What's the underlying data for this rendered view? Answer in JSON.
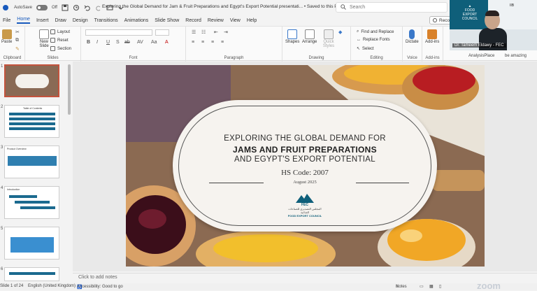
{
  "titlebar": {
    "autosave_label": "AutoSave",
    "autosave_state": "Off",
    "doc_title": "Exploring the Global Demand for Jam & Fruit Preparations and Egypt's Export Potential presentati...",
    "saved_status": "• Saved to this PC",
    "search_placeholder": "Search"
  },
  "menu": [
    "File",
    "Home",
    "Insert",
    "Draw",
    "Design",
    "Transitions",
    "Animations",
    "Slide Show",
    "Record",
    "Review",
    "View",
    "Help"
  ],
  "menu_active": "Home",
  "record_button": "Record",
  "ribbon": {
    "clipboard": {
      "paste": "Paste",
      "label": "Clipboard"
    },
    "slides": {
      "new_slide": "New Slide",
      "layout": "Layout",
      "reset": "Reset",
      "section": "Section",
      "label": "Slides"
    },
    "font": {
      "label": "Font",
      "buttons": [
        "B",
        "I",
        "U",
        "S",
        "ab",
        "AV",
        "Aa",
        "A"
      ]
    },
    "paragraph": {
      "label": "Paragraph"
    },
    "drawing": {
      "shapes": "Shapes",
      "arrange": "Arrange",
      "quick_styles": "Quick Styles",
      "label": "Drawing"
    },
    "editing": {
      "find_replace": "Find and Replace",
      "replace_fonts": "Replace Fonts",
      "select": "Select",
      "label": "Editing"
    },
    "voice": {
      "dictate": "Dictate",
      "label": "Voice"
    },
    "addins": {
      "addins": "Add-ins",
      "label": "Add-ins"
    }
  },
  "webcam": {
    "participant_name": "Dr. Tameem Eldawy - FEC",
    "logo_text": "FOOD EXPORT COUNCIL",
    "side_text": "IIB"
  },
  "under_webcam": {
    "left": "AnalysisPlace",
    "right": "be amazing"
  },
  "thumbnails": [
    {
      "num": "1",
      "title": ""
    },
    {
      "num": "2",
      "title": "Table of Contents"
    },
    {
      "num": "3",
      "title": "Product Overview"
    },
    {
      "num": "4",
      "title": "Introduction"
    },
    {
      "num": "5",
      "title": ""
    },
    {
      "num": "6",
      "title": ""
    }
  ],
  "slide": {
    "line1": "EXPLORING THE GLOBAL DEMAND FOR",
    "line2": "JAMS AND FRUIT PREPARATIONS",
    "line3": "AND EGYPT'S EXPORT POTENTIAL",
    "hs_code": "HS Code: 2007",
    "date": "August 2025",
    "logo_text": "FOOD EXPORT COUNCIL",
    "logo_arabic": "المجلس التصديري للصناعات الغذائية",
    "logo_abbr": "FEC"
  },
  "notes_placeholder": "Click to add notes",
  "status": {
    "slide_counter": "Slide 1 of 24",
    "language": "English (United Kingdom)",
    "accessibility": "Accessibility: Good to go",
    "notes": "Notes",
    "zoom_brand": "zoom"
  },
  "colors": {
    "accent": "#185abd",
    "selection": "#c4533d",
    "slide_text_dark": "#2d2d2d",
    "fec_teal": "#0f5f7a"
  }
}
